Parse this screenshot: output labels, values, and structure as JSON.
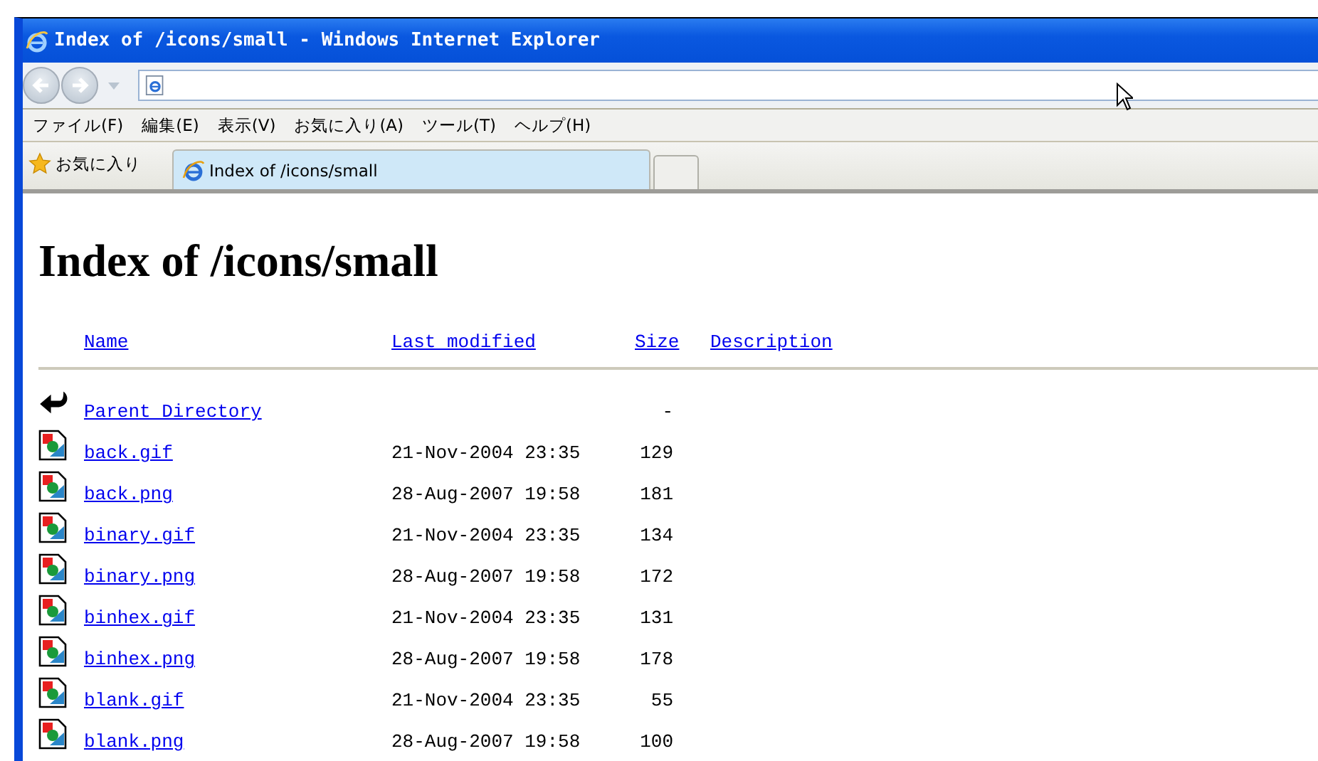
{
  "window": {
    "title": "Index of /icons/small - Windows Internet Explorer"
  },
  "menu": [
    "ファイル(F)",
    "編集(E)",
    "表示(V)",
    "お気に入り(A)",
    "ツール(T)",
    "ヘルプ(H)"
  ],
  "favorites": {
    "label": "お気に入り"
  },
  "tabs": [
    {
      "label": "Index of /icons/small",
      "selected": true
    }
  ],
  "page": {
    "heading": "Index of /icons/small",
    "columns": [
      "Name",
      "Last modified",
      "Size",
      "Description"
    ],
    "rows": [
      {
        "kind": "parent",
        "name": "Parent Directory",
        "size": "-"
      },
      {
        "kind": "file",
        "name": "back.gif",
        "modified": "21-Nov-2004 23:35",
        "size": "129"
      },
      {
        "kind": "file",
        "name": "back.png",
        "modified": "28-Aug-2007 19:58",
        "size": "181"
      },
      {
        "kind": "file",
        "name": "binary.gif",
        "modified": "21-Nov-2004 23:35",
        "size": "134"
      },
      {
        "kind": "file",
        "name": "binary.png",
        "modified": "28-Aug-2007 19:58",
        "size": "172"
      },
      {
        "kind": "file",
        "name": "binhex.gif",
        "modified": "21-Nov-2004 23:35",
        "size": "131"
      },
      {
        "kind": "file",
        "name": "binhex.png",
        "modified": "28-Aug-2007 19:58",
        "size": "178"
      },
      {
        "kind": "file",
        "name": "blank.gif",
        "modified": "21-Nov-2004 23:35",
        "size": "55"
      },
      {
        "kind": "file",
        "name": "blank.png",
        "modified": "28-Aug-2007 19:58",
        "size": "100"
      }
    ]
  }
}
